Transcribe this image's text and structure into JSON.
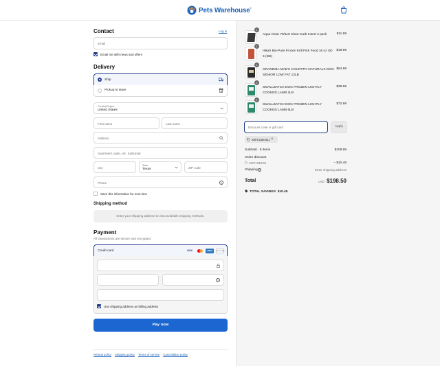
{
  "header": {
    "brand_part1": "Pets",
    "brand_part2": "Warehouse",
    "brand_tm": "®"
  },
  "contact": {
    "title": "Contact",
    "login_link": "Log in",
    "email_placeholder": "Email",
    "newsletter_label": "Email me with news and offers"
  },
  "delivery": {
    "title": "Delivery",
    "option_ship": "Ship",
    "option_pickup": "Pickup in store",
    "country_label": "Country/Region",
    "country_value": "United States",
    "first_name_placeholder": "First name",
    "last_name_placeholder": "Last name",
    "address_placeholder": "Address",
    "apartment_placeholder": "Apartment, suite, etc. (optional)",
    "city_placeholder": "City",
    "state_label": "State",
    "state_value": "Texas",
    "zip_placeholder": "ZIP code",
    "phone_placeholder": "Phone",
    "save_info_label": "Save this information for next time"
  },
  "shipping_method": {
    "title": "Shipping method",
    "notice": "Enter your shipping address to view available shipping methods."
  },
  "payment": {
    "title": "Payment",
    "subtitle": "All transactions are secure and encrypted.",
    "method_label": "Credit card",
    "card_brands": [
      "VISA",
      "mastercard",
      "AMEX",
      "DISCOVER"
    ],
    "billing_label": "Use shipping address as billing address",
    "pay_button": "Pay now"
  },
  "footer": {
    "links": [
      "Refund policy",
      "Shipping policy",
      "Terms of service",
      "Cancellation policy"
    ]
  },
  "order": {
    "items": [
      {
        "qty": "1",
        "name": "Aqua Clear 70/110 Clear-Carb Insert 2 pack",
        "price": "$11.99"
      },
      {
        "qty": "1",
        "name": "Hikari Bio-Pure Frozen Krill Fish Food 16 oz SD 5 (DD)",
        "price": "$18.99"
      },
      {
        "qty": "1",
        "name": "GRANDMA MAE'S COUNTRY NATURALS DOG SENIOR LOW FAT 12LB",
        "price": "$64.99"
      },
      {
        "qty": "1",
        "name": "SMALLBATCH DOG FROZEN LIGHTLY COOKED LAMB 2LB",
        "price": "$39.99"
      },
      {
        "qty": "1",
        "name": "SMALLBATCH DOG FROZEN LIGHTLY COOKED LAMB 6LB",
        "price": "$72.99"
      }
    ],
    "discount_placeholder": "Discount code or gift card",
    "apply_button": "Apply",
    "applied_code": "XW71SE4GJ",
    "subtotal_label": "Subtotal · 5 items",
    "subtotal_value": "$208.95",
    "order_discount_label": "Order discount",
    "discount_code": "XW71SE4GJ",
    "discount_value": "− $10.45",
    "shipping_label": "Shipping",
    "shipping_value": "Enter shipping address",
    "total_label": "Total",
    "currency": "USD",
    "total_value": "$198.50",
    "savings_label": "TOTAL SAVINGS",
    "savings_value": "$10.45"
  },
  "colors": {
    "primary": "#1e63b8",
    "pay_button": "#1b66d1",
    "summary_bg": "#f5f5f5"
  }
}
